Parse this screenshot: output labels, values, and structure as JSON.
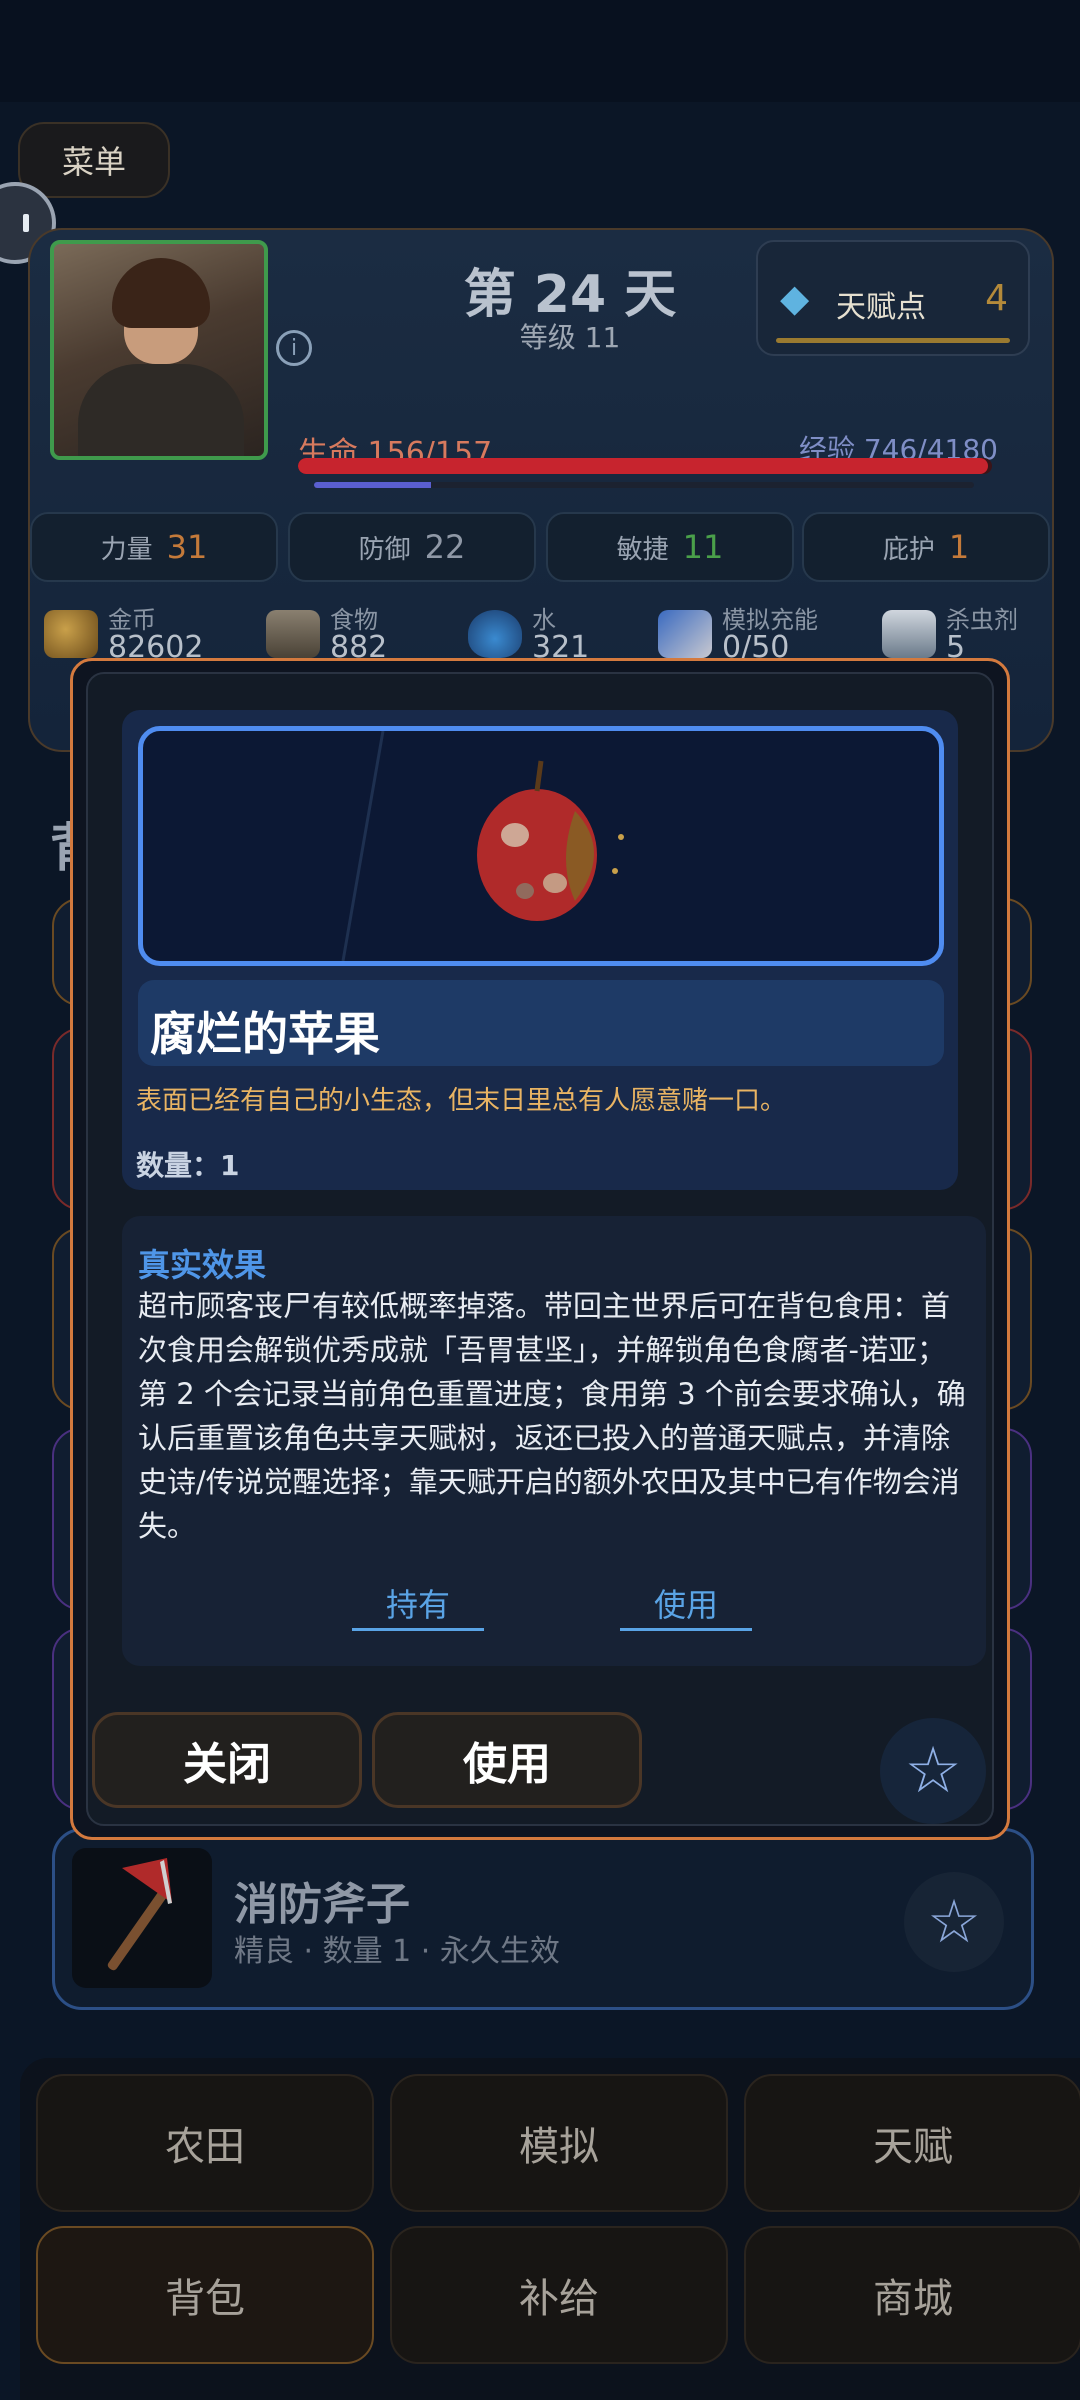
{
  "header": {
    "menu_label": "菜单"
  },
  "player": {
    "day_title": "第 24 天",
    "level": "等级 11",
    "talent_label": "天赋点",
    "talent_points": "4",
    "hp_text": "生命 156/157",
    "hp_fraction": 0.994,
    "xp_text": "经验 746/4180",
    "xp_fraction": 0.178
  },
  "stats": [
    {
      "name": "力量",
      "value": "31",
      "color": "#c47a3a"
    },
    {
      "name": "防御",
      "value": "22",
      "color": "#8f98a6"
    },
    {
      "name": "敏捷",
      "value": "11",
      "color": "#4aa04a"
    },
    {
      "name": "庇护",
      "value": "1",
      "color": "#c47a3a"
    }
  ],
  "resources": [
    {
      "name": "金币",
      "value": "82602"
    },
    {
      "name": "食物",
      "value": "882"
    },
    {
      "name": "水",
      "value": "321"
    },
    {
      "name": "模拟充能",
      "value": "0/50"
    },
    {
      "name": "杀虫剂",
      "value": "5"
    }
  ],
  "background": {
    "heading": "背",
    "axe_item": {
      "name": "消防斧子",
      "meta": "精良 · 数量 1 · 永久生效"
    }
  },
  "modal": {
    "item_name": "腐烂的苹果",
    "item_desc": "表面已经有自己的小生态，但末日里总有人愿意赌一口。",
    "item_qty": "数量：1",
    "effect_title": "真实效果",
    "effect_text": "超市顾客丧尸有较低概率掉落。带回主世界后可在背包食用：首次食用会解锁优秀成就「吾胃甚坚」，并解锁角色食腐者-诺亚；第 2 个会记录当前角色重置进度；食用第 3 个前会要求确认，确认后重置该角色共享天赋树，返还已投入的普通天赋点，并清除史诗/传说觉醒选择；靠天赋开启的额外农田及其中已有作物会消失。",
    "link_hold": "持有",
    "link_use": "使用",
    "close_label": "关闭",
    "use_label": "使用"
  },
  "nav": [
    {
      "label": "农田",
      "active": false
    },
    {
      "label": "模拟",
      "active": false
    },
    {
      "label": "天赋",
      "active": false
    },
    {
      "label": "背包",
      "active": true
    },
    {
      "label": "补给",
      "active": false
    },
    {
      "label": "商城",
      "active": false
    }
  ],
  "colors": {
    "accent_orange": "#d47a3e",
    "accent_blue": "#4f8cf0",
    "hp_red": "#c7242e",
    "xp_purple": "#5a5fd0"
  }
}
